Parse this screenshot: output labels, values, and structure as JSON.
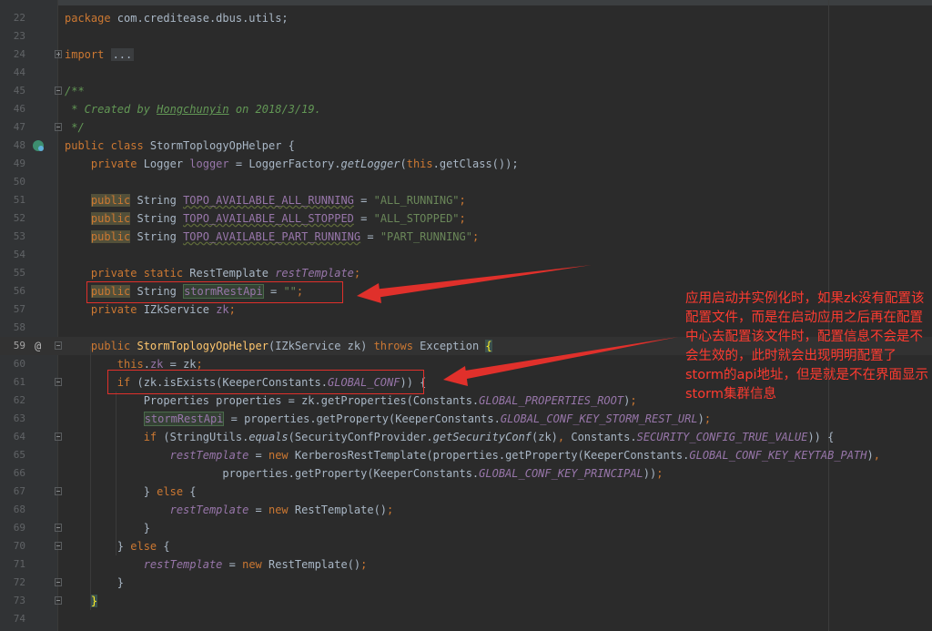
{
  "editor": {
    "lines": [
      {
        "n": "22",
        "segs": [
          [
            "kw",
            "package "
          ],
          [
            "",
            "com.creditease.dbus.utils;"
          ]
        ]
      },
      {
        "n": "23",
        "segs": []
      },
      {
        "n": "24",
        "fold": "plus",
        "segs": [
          [
            "kw",
            "import "
          ],
          [
            "fold-txt",
            "..."
          ]
        ]
      },
      {
        "n": "44",
        "segs": []
      },
      {
        "n": "45",
        "fold": "minus",
        "segs": [
          [
            "cm",
            "/**"
          ]
        ]
      },
      {
        "n": "46",
        "segs": [
          [
            "cm",
            " * Created by "
          ],
          [
            "cmu",
            "Hongchunyin"
          ],
          [
            "cm",
            " on 2018/3/19."
          ]
        ]
      },
      {
        "n": "47",
        "fold": "minus",
        "segs": [
          [
            "cm",
            " */"
          ]
        ]
      },
      {
        "n": "48",
        "icon": "run",
        "segs": [
          [
            "kw",
            "public class "
          ],
          [
            "",
            "StormToplogyOpHelper {"
          ]
        ]
      },
      {
        "n": "49",
        "segs": [
          [
            "",
            "    "
          ],
          [
            "kw",
            "private "
          ],
          [
            "",
            "Logger "
          ],
          [
            "fld",
            "logger"
          ],
          [
            "",
            " = LoggerFactory."
          ],
          [
            "it",
            "getLogger"
          ],
          [
            "",
            "("
          ],
          [
            "kw",
            "this"
          ],
          [
            "",
            ".getClass());"
          ]
        ]
      },
      {
        "n": "50",
        "segs": []
      },
      {
        "n": "51",
        "segs": [
          [
            "",
            "    "
          ],
          [
            "kw hlkw",
            "public"
          ],
          [
            "",
            " String "
          ],
          [
            "fld ul",
            "TOPO_AVAILABLE_ALL_RUNNING"
          ],
          [
            "",
            " = "
          ],
          [
            "st",
            "\"ALL_RUNNING\""
          ],
          [
            "kw",
            ";"
          ]
        ]
      },
      {
        "n": "52",
        "segs": [
          [
            "",
            "    "
          ],
          [
            "kw hlkw",
            "public"
          ],
          [
            "",
            " String "
          ],
          [
            "fld ul",
            "TOPO_AVAILABLE_ALL_STOPPED"
          ],
          [
            "",
            " = "
          ],
          [
            "st",
            "\"ALL_STOPPED\""
          ],
          [
            "kw",
            ";"
          ]
        ]
      },
      {
        "n": "53",
        "segs": [
          [
            "",
            "    "
          ],
          [
            "kw hlkw",
            "public"
          ],
          [
            "",
            " String "
          ],
          [
            "fld ul",
            "TOPO_AVAILABLE_PART_RUNNING"
          ],
          [
            "",
            " = "
          ],
          [
            "st",
            "\"PART_RUNNING\""
          ],
          [
            "kw",
            ";"
          ]
        ]
      },
      {
        "n": "54",
        "segs": []
      },
      {
        "n": "55",
        "segs": [
          [
            "",
            "    "
          ],
          [
            "kw",
            "private static "
          ],
          [
            "",
            "RestTemplate "
          ],
          [
            "fldi",
            "restTemplate"
          ],
          [
            "kw",
            ";"
          ]
        ]
      },
      {
        "n": "56",
        "segs": [
          [
            "",
            "    "
          ],
          [
            "kw hlkw",
            "public"
          ],
          [
            "",
            " String "
          ],
          [
            "fld hlvar",
            "stormRestApi"
          ],
          [
            "",
            " = "
          ],
          [
            "st",
            "\"\""
          ],
          [
            "kw",
            ";"
          ]
        ]
      },
      {
        "n": "57",
        "segs": [
          [
            "",
            "    "
          ],
          [
            "kw",
            "private "
          ],
          [
            "",
            "IZkService "
          ],
          [
            "fld",
            "zk"
          ],
          [
            "kw",
            ";"
          ]
        ]
      },
      {
        "n": "58",
        "segs": []
      },
      {
        "n": "59",
        "caret": true,
        "icon": "at",
        "fold": "minus",
        "segs": [
          [
            "",
            "    "
          ],
          [
            "kw",
            "public "
          ],
          [
            "fn",
            "StormToplogyOpHelper"
          ],
          [
            "",
            "(IZkService zk) "
          ],
          [
            "kw",
            "throws "
          ],
          [
            "",
            "Exception "
          ],
          [
            "brace",
            "{"
          ]
        ]
      },
      {
        "n": "60",
        "segs": [
          [
            "",
            "        "
          ],
          [
            "kw",
            "this"
          ],
          [
            "",
            "."
          ],
          [
            "fld",
            "zk"
          ],
          [
            "",
            " = zk"
          ],
          [
            "kw",
            ";"
          ]
        ]
      },
      {
        "n": "61",
        "fold": "minus",
        "segs": [
          [
            "",
            "        "
          ],
          [
            "kw",
            "if "
          ],
          [
            "",
            "(zk.isExists(KeeperConstants."
          ],
          [
            "cst",
            "GLOBAL_CONF"
          ],
          [
            "",
            ")) {"
          ]
        ]
      },
      {
        "n": "62",
        "segs": [
          [
            "",
            "            Properties properties = zk.getProperties(Constants."
          ],
          [
            "cst",
            "GLOBAL_PROPERTIES_ROOT"
          ],
          [
            "",
            ")"
          ],
          [
            "kw",
            ";"
          ]
        ]
      },
      {
        "n": "63",
        "segs": [
          [
            "",
            "            "
          ],
          [
            "fld hlvar",
            "stormRestApi"
          ],
          [
            "",
            " = properties.getProperty(KeeperConstants."
          ],
          [
            "cst",
            "GLOBAL_CONF_KEY_STORM_REST_URL"
          ],
          [
            "",
            ")"
          ],
          [
            "kw",
            ";"
          ]
        ]
      },
      {
        "n": "64",
        "fold": "minus",
        "segs": [
          [
            "",
            "            "
          ],
          [
            "kw",
            "if "
          ],
          [
            "",
            "(StringUtils."
          ],
          [
            "it",
            "equals"
          ],
          [
            "",
            "(SecurityConfProvider."
          ],
          [
            "it",
            "getSecurityConf"
          ],
          [
            "",
            "(zk)"
          ],
          [
            "kw",
            ", "
          ],
          [
            "",
            "Constants."
          ],
          [
            "cst",
            "SECURITY_CONFIG_TRUE_VALUE"
          ],
          [
            "",
            ")) {"
          ]
        ]
      },
      {
        "n": "65",
        "segs": [
          [
            "",
            "                "
          ],
          [
            "fldi",
            "restTemplate"
          ],
          [
            "",
            " = "
          ],
          [
            "kw",
            "new "
          ],
          [
            "",
            "KerberosRestTemplate(properties.getProperty(KeeperConstants."
          ],
          [
            "cst",
            "GLOBAL_CONF_KEY_KEYTAB_PATH"
          ],
          [
            "",
            ")"
          ],
          [
            "kw",
            ","
          ]
        ]
      },
      {
        "n": "66",
        "segs": [
          [
            "",
            "                        properties.getProperty(KeeperConstants."
          ],
          [
            "cst",
            "GLOBAL_CONF_KEY_PRINCIPAL"
          ],
          [
            "",
            "))"
          ],
          [
            "kw",
            ";"
          ]
        ]
      },
      {
        "n": "67",
        "fold": "minus",
        "segs": [
          [
            "",
            "            } "
          ],
          [
            "kw",
            "else "
          ],
          [
            "",
            "{"
          ]
        ]
      },
      {
        "n": "68",
        "segs": [
          [
            "",
            "                "
          ],
          [
            "fldi",
            "restTemplate"
          ],
          [
            "",
            " = "
          ],
          [
            "kw",
            "new "
          ],
          [
            "",
            "RestTemplate()"
          ],
          [
            "kw",
            ";"
          ]
        ]
      },
      {
        "n": "69",
        "fold": "minus",
        "segs": [
          [
            "",
            "            }"
          ]
        ]
      },
      {
        "n": "70",
        "fold": "minus",
        "segs": [
          [
            "",
            "        } "
          ],
          [
            "kw",
            "else "
          ],
          [
            "",
            "{"
          ]
        ]
      },
      {
        "n": "71",
        "segs": [
          [
            "",
            "            "
          ],
          [
            "fldi",
            "restTemplate"
          ],
          [
            "",
            " = "
          ],
          [
            "kw",
            "new "
          ],
          [
            "",
            "RestTemplate()"
          ],
          [
            "kw",
            ";"
          ]
        ]
      },
      {
        "n": "72",
        "fold": "minus",
        "segs": [
          [
            "",
            "        }"
          ]
        ]
      },
      {
        "n": "73",
        "fold": "minus",
        "segs": [
          [
            "",
            "    "
          ],
          [
            "brace",
            "}"
          ]
        ]
      },
      {
        "n": "74",
        "segs": []
      }
    ]
  },
  "callout": {
    "text": "应用启动并实例化时，如果zk没有配置该配置文件，而是在启动应用之后再在配置中心去配置该文件时，配置信息不会是不会生效的，此时就会出现明明配置了storm的api地址，但是就是不在界面显示storm集群信息"
  },
  "colors": {
    "annotation_red": "#e0302b",
    "keyword": "#cc7832",
    "string": "#6a8759",
    "field": "#9876aa",
    "comment": "#629755"
  }
}
